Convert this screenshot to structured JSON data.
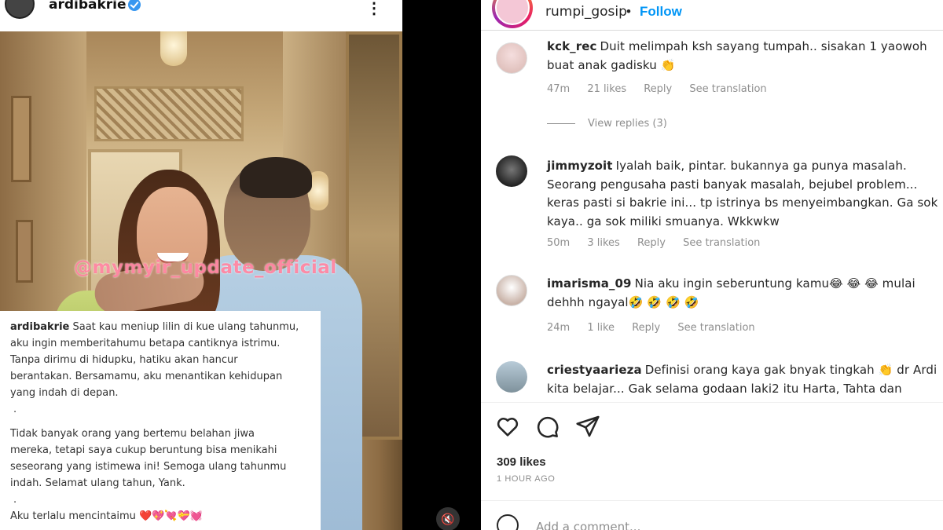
{
  "left_post": {
    "username": "ardibakrie",
    "more_icon": "more-options-icon",
    "watermark": "@mymyir_update_official",
    "caption": {
      "username": "ardibakrie",
      "paragraph1": "Saat kau meniup lilin di kue ulang tahunmu,\naku ingin memberitahumu betapa cantiknya istrimu.\nTanpa dirimu di hidupku, hatiku akan hancur\nberantakan. Bersamamu, aku menantikan kehidupan\nyang indah di depan.",
      "dot1": ".",
      "paragraph2": "Tidak banyak orang yang bertemu belahan jiwa\nmereka, tetapi saya cukup beruntung bisa menikahi\nseseorang yang istimewa ini! Semoga ulang tahunmu\nindah. Selamat ulang tahun, Yank.",
      "dot2": ".",
      "paragraph3": "Aku terlalu mencintaimu ❤️💖💘💝💓"
    }
  },
  "post_panel": {
    "header": {
      "username": "rumpi_gosip",
      "separator": "•",
      "follow_label": "Follow"
    },
    "comments": [
      {
        "username": "kck_rec",
        "text": "Duit melimpah ksh sayang tumpah.. sisakan 1 yaowoh buat anak gadisku 👏",
        "time": "47m",
        "likes": "21 likes",
        "reply": "Reply",
        "translate": "See translation"
      },
      {
        "username": "jimmyzoit",
        "text": "Iyalah baik, pintar. bukannya ga punya masalah. Seorang pengusaha pasti banyak masalah, bejubel problem... keras pasti si bakrie ini... tp istrinya bs menyeimbangkan. Ga sok kaya.. ga sok miliki smuanya. Wkkwkw",
        "time": "50m",
        "likes": "3 likes",
        "reply": "Reply",
        "translate": "See translation"
      },
      {
        "username": "imarisma_09",
        "text": "Nia aku ingin seberuntung kamu😂 😂 😂 mulai dehhh ngayal🤣 🤣 🤣 🤣",
        "time": "24m",
        "likes": "1 like",
        "reply": "Reply",
        "translate": "See translation"
      },
      {
        "username": "criestyaarieza",
        "text": "Definisi orang kaya gak bnyak tingkah 👏 dr Ardi kita belajar... Gak selama godaan laki2 itu Harta, Tahta dan",
        "time": "",
        "likes": "",
        "reply": "",
        "translate": ""
      }
    ],
    "view_replies": "View replies (3)",
    "likes_count": "309 likes",
    "time_ago": "1 HOUR AGO",
    "add_comment_placeholder": "Add a comment..."
  },
  "colors": {
    "accent": "#0095f6",
    "text": "#262626",
    "secondary": "#8e8e8e"
  }
}
